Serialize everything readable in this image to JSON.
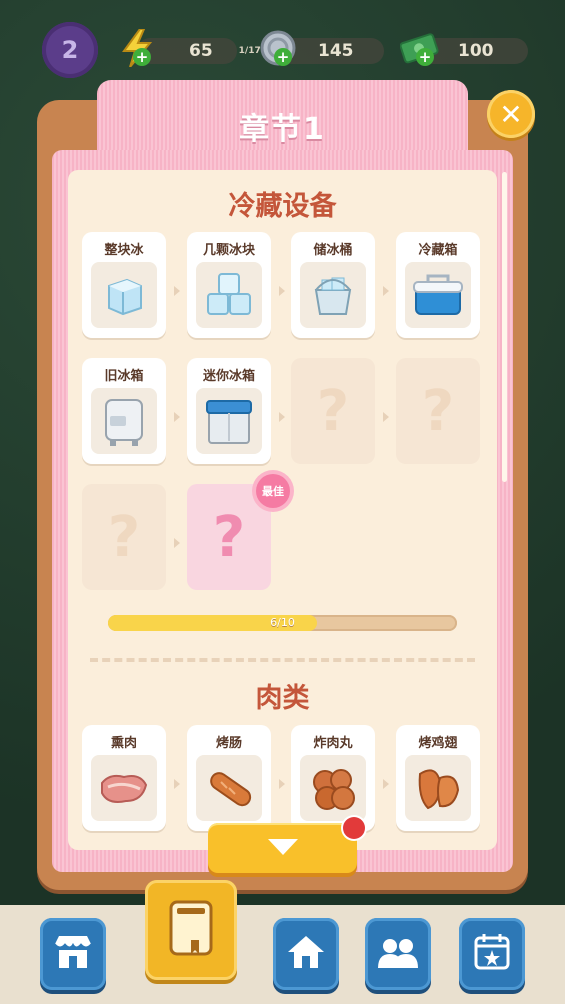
{
  "topbar": {
    "level": "2",
    "energy": {
      "value": "65",
      "sub": "1/17",
      "icon": "lightning-icon"
    },
    "coins": {
      "value": "145",
      "icon": "coin-icon"
    },
    "cash": {
      "value": "100",
      "icon": "cash-icon"
    }
  },
  "chapter": {
    "title": "章节1"
  },
  "sections": [
    {
      "title": "冷藏设备",
      "items": [
        {
          "label": "整块冰",
          "icon": "ice-block-icon"
        },
        {
          "label": "几颗冰块",
          "icon": "ice-cubes-icon"
        },
        {
          "label": "储冰桶",
          "icon": "ice-bucket-icon"
        },
        {
          "label": "冷藏箱",
          "icon": "cooler-box-icon"
        },
        {
          "label": "旧冰箱",
          "icon": "old-fridge-icon"
        },
        {
          "label": "迷你冰箱",
          "icon": "mini-fridge-icon"
        }
      ],
      "locked_mark": "?",
      "best_badge": "最佳",
      "progress": {
        "text": "6/10",
        "value": 0.6
      }
    },
    {
      "title": "肉类",
      "items": [
        {
          "label": "熏肉",
          "icon": "bacon-icon"
        },
        {
          "label": "烤肠",
          "icon": "sausage-icon"
        },
        {
          "label": "炸肉丸",
          "icon": "meatball-icon"
        },
        {
          "label": "烤鸡翅",
          "icon": "chicken-wing-icon"
        }
      ]
    }
  ],
  "bottom_nav": [
    {
      "name": "shop",
      "icon": "shop-icon"
    },
    {
      "name": "collection-book",
      "icon": "book-icon"
    },
    {
      "name": "home",
      "icon": "home-icon"
    },
    {
      "name": "friends",
      "icon": "friends-icon"
    },
    {
      "name": "calendar",
      "icon": "calendar-icon"
    }
  ],
  "colors": {
    "accent": "#c4563a",
    "pink": "#f9c5d4",
    "gold": "#f9c02a"
  }
}
